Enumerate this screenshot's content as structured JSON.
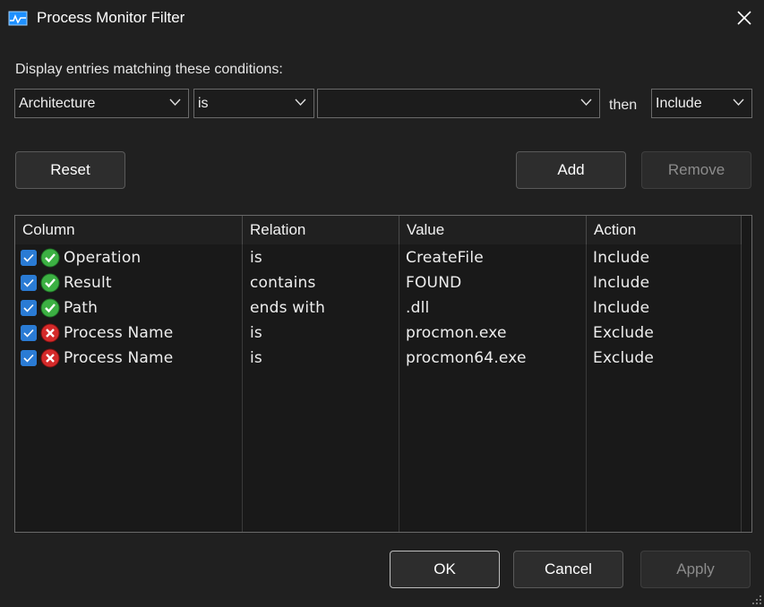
{
  "window": {
    "title": "Process Monitor Filter"
  },
  "filter": {
    "prompt": "Display entries matching these conditions:",
    "column_value": "Architecture",
    "relation_value": "is",
    "value_value": "",
    "then_label": "then",
    "action_value": "Include"
  },
  "buttons": {
    "reset": "Reset",
    "add": "Add",
    "remove": "Remove",
    "ok": "OK",
    "cancel": "Cancel",
    "apply": "Apply"
  },
  "list": {
    "headers": [
      "Column",
      "Relation",
      "Value",
      "Action"
    ],
    "rows": [
      {
        "checked": true,
        "status": "include-icon",
        "column": "Operation",
        "relation": "is",
        "value": "CreateFile",
        "action": "Include"
      },
      {
        "checked": true,
        "status": "include-icon",
        "column": "Result",
        "relation": "contains",
        "value": "FOUND",
        "action": "Include"
      },
      {
        "checked": true,
        "status": "include-icon",
        "column": "Path",
        "relation": "ends with",
        "value": ".dll",
        "action": "Include"
      },
      {
        "checked": true,
        "status": "exclude-icon",
        "column": "Process Name",
        "relation": "is",
        "value": "procmon.exe",
        "action": "Exclude"
      },
      {
        "checked": true,
        "status": "exclude-icon",
        "column": "Process Name",
        "relation": "is",
        "value": "procmon64.exe",
        "action": "Exclude"
      }
    ]
  },
  "colors": {
    "accent": "#2a7bd4",
    "include_green": "#3cb043",
    "exclude_red": "#d42a2a"
  }
}
